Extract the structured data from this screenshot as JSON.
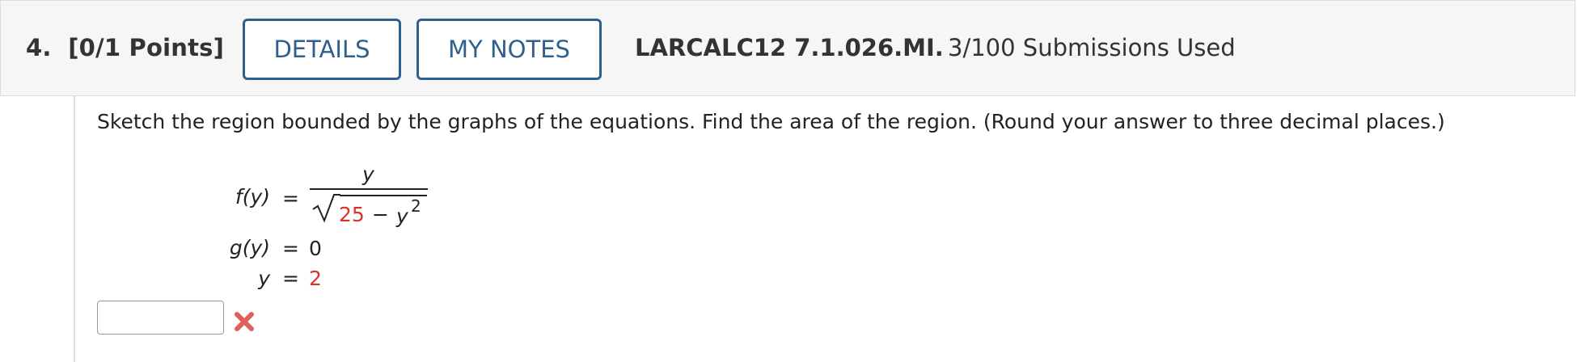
{
  "question": {
    "number_label": "4.",
    "points_label": "[0/1 Points]",
    "details_label": "DETAILS",
    "notes_label": "MY NOTES",
    "code": "LARCALC12 7.1.026.MI.",
    "submissions": "3/100 Submissions Used"
  },
  "problem": {
    "prompt": "Sketch the region bounded by the graphs of the equations. Find the area of the region. (Round your answer to three decimal places.)",
    "f_lhs": "f(y)",
    "f_num": "y",
    "f_den_const": "25",
    "f_den_minus": "−",
    "f_den_var": "y",
    "f_den_exp": "2",
    "g_lhs": "g(y)",
    "g_rhs": "0",
    "y_lhs": "y",
    "y_rhs": "2",
    "equals": "="
  },
  "answer": {
    "value": "",
    "status": "incorrect"
  },
  "colors": {
    "accent": "#2f5f8f",
    "highlight": "#d8322a"
  },
  "icons": {
    "status": "incorrect-x-icon"
  }
}
